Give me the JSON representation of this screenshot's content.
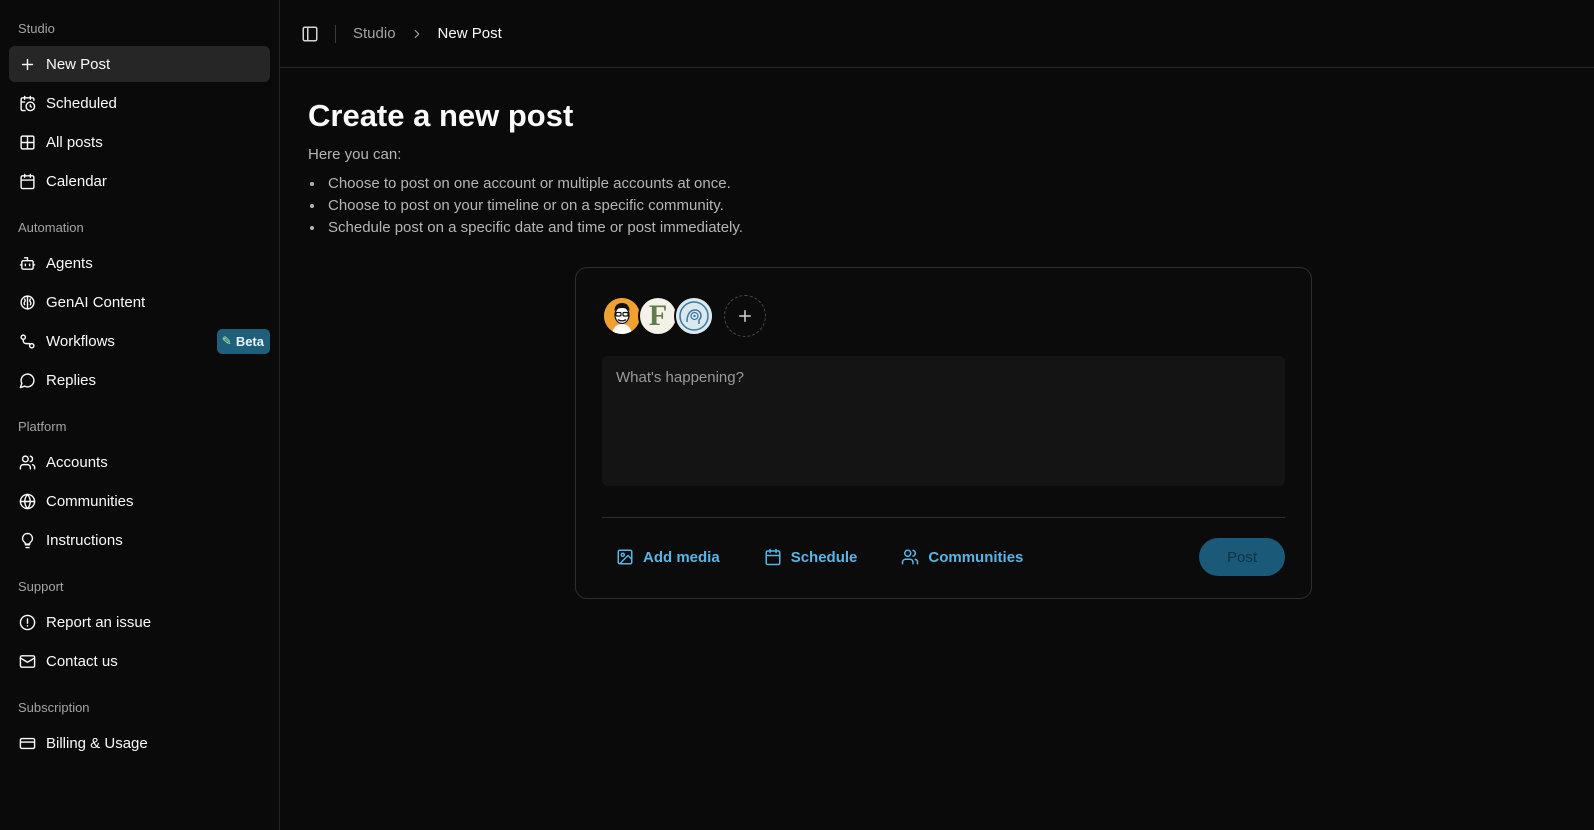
{
  "sidebar": {
    "groups": [
      {
        "label": "Studio",
        "items": [
          {
            "label": "New Post",
            "icon": "plus-icon",
            "active": true
          },
          {
            "label": "Scheduled",
            "icon": "calendar-clock-icon"
          },
          {
            "label": "All posts",
            "icon": "grid-icon"
          },
          {
            "label": "Calendar",
            "icon": "calendar-icon"
          }
        ]
      },
      {
        "label": "Automation",
        "items": [
          {
            "label": "Agents",
            "icon": "bot-icon"
          },
          {
            "label": "GenAI Content",
            "icon": "brain-icon"
          },
          {
            "label": "Workflows",
            "icon": "workflow-icon",
            "badge": "Beta"
          },
          {
            "label": "Replies",
            "icon": "message-circle-icon"
          }
        ]
      },
      {
        "label": "Platform",
        "items": [
          {
            "label": "Accounts",
            "icon": "users-icon"
          },
          {
            "label": "Communities",
            "icon": "globe-icon"
          },
          {
            "label": "Instructions",
            "icon": "lightbulb-icon"
          }
        ]
      },
      {
        "label": "Support",
        "items": [
          {
            "label": "Report an issue",
            "icon": "alert-circle-icon"
          },
          {
            "label": "Contact us",
            "icon": "mail-icon"
          }
        ]
      },
      {
        "label": "Subscription",
        "items": [
          {
            "label": "Billing & Usage",
            "icon": "credit-card-icon"
          }
        ]
      }
    ]
  },
  "breadcrumb": {
    "parent": "Studio",
    "current": "New Post"
  },
  "page": {
    "title": "Create a new post",
    "intro": "Here you can:",
    "bullets": [
      "Choose to post on one account or multiple accounts at once.",
      "Choose to post on your timeline or on a specific community.",
      "Schedule post on a specific date and time or post immediately."
    ]
  },
  "composer": {
    "placeholder": "What's happening?",
    "avatars": [
      "avatar-person",
      "avatar-letter-f",
      "avatar-brain"
    ],
    "avatar_letter": "F",
    "actions": {
      "add_media": "Add media",
      "schedule": "Schedule",
      "communities": "Communities"
    },
    "post_label": "Post"
  },
  "colors": {
    "accent": "#5ab4e6",
    "post_button": "#1a5a78",
    "beta_badge": "#1f5f7a",
    "background": "#0a0a0a"
  }
}
